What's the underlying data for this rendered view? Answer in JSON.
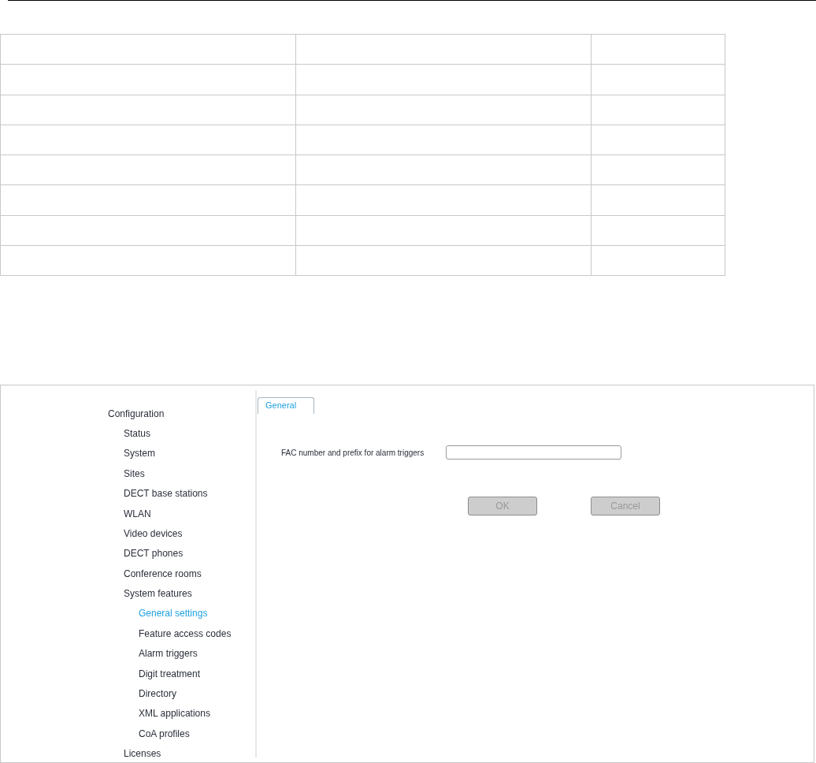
{
  "empty_table": {
    "columns": [
      {
        "kind": "wide"
      },
      {
        "kind": "wide"
      },
      {
        "kind": "narrow"
      }
    ],
    "rows": [
      {
        "kind": "blank"
      },
      {
        "kind": "blank"
      },
      {
        "kind": "blank"
      },
      {
        "kind": "blank"
      },
      {
        "kind": "blank"
      },
      {
        "kind": "blank"
      },
      {
        "kind": "blank"
      },
      {
        "kind": "blank"
      }
    ]
  },
  "sidebar": {
    "items": [
      {
        "label": "Configuration",
        "selected": false,
        "children": [
          {
            "label": "Status",
            "selected": false
          },
          {
            "label": "System",
            "selected": false
          },
          {
            "label": "Sites",
            "selected": false
          },
          {
            "label": "DECT base stations",
            "selected": false
          },
          {
            "label": "WLAN",
            "selected": false
          },
          {
            "label": "Video devices",
            "selected": false
          },
          {
            "label": "DECT phones",
            "selected": false
          },
          {
            "label": "Conference rooms",
            "selected": false
          },
          {
            "label": "System features",
            "selected": false,
            "children": [
              {
                "label": "General settings",
                "selected": true
              },
              {
                "label": "Feature access codes",
                "selected": false
              },
              {
                "label": "Alarm triggers",
                "selected": false
              },
              {
                "label": "Digit treatment",
                "selected": false
              },
              {
                "label": "Directory",
                "selected": false
              },
              {
                "label": "XML applications",
                "selected": false
              },
              {
                "label": "CoA profiles",
                "selected": false
              }
            ]
          },
          {
            "label": "Licenses",
            "selected": false
          }
        ]
      }
    ]
  },
  "tabs": [
    {
      "label": "General",
      "selected": true
    }
  ],
  "form": {
    "fields": [
      {
        "label": "FAC number and prefix for alarm triggers"
      }
    ]
  },
  "buttons": [
    {
      "label": "OK",
      "disabled": true
    },
    {
      "label": "Cancel",
      "disabled": true
    }
  ]
}
